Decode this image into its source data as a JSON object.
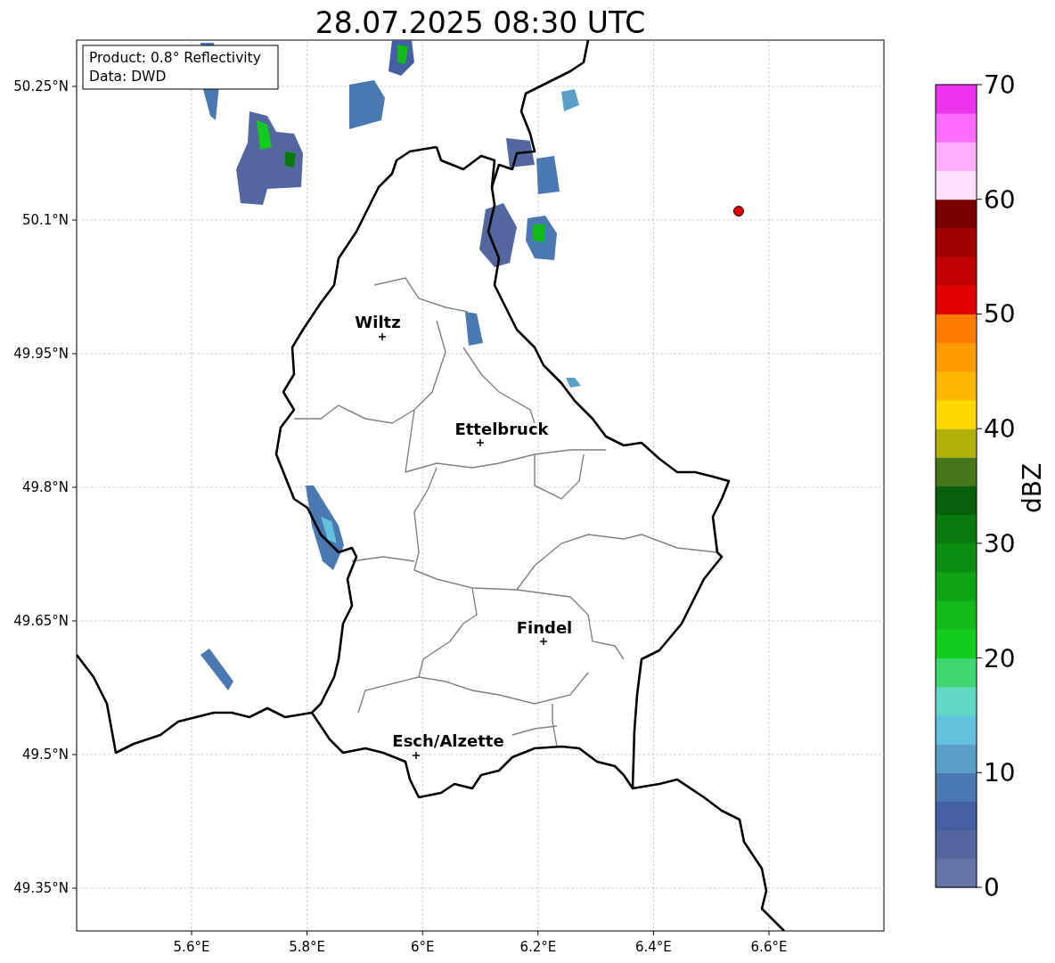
{
  "title": "28.07.2025 08:30 UTC",
  "legend": {
    "lines": [
      "Product: 0.8° Reflectivity",
      "Data: DWD"
    ]
  },
  "map": {
    "y_ticks": [
      "50.25°N",
      "50.1°N",
      "49.95°N",
      "49.8°N",
      "49.65°N",
      "49.5°N",
      "49.35°N"
    ],
    "x_ticks": [
      "5.6°E",
      "5.8°E",
      "6°E",
      "6.2°E",
      "6.4°E",
      "6.6°E"
    ],
    "cities": [
      {
        "name": "Wiltz"
      },
      {
        "name": "Ettelbruck"
      },
      {
        "name": "Findel"
      },
      {
        "name": "Esch/Alzette"
      }
    ]
  },
  "colorbar": {
    "ticks": [
      "70",
      "60",
      "50",
      "40",
      "30",
      "20",
      "10",
      "0"
    ],
    "label": "dBZ"
  }
}
